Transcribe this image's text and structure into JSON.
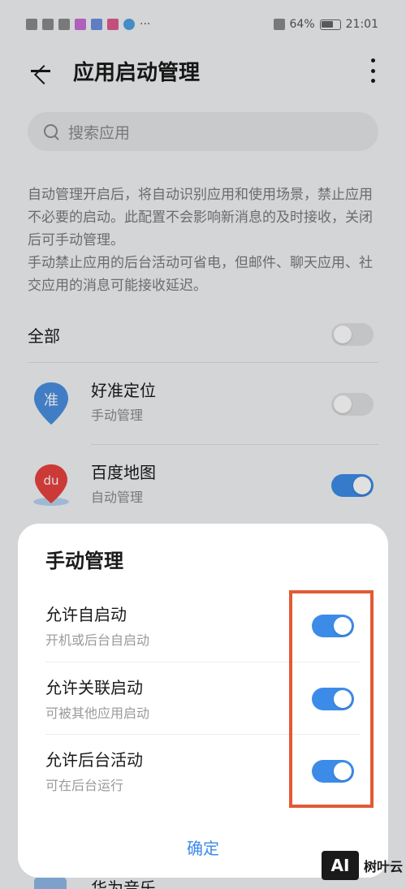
{
  "status_bar": {
    "battery": "64%",
    "time": "21:01",
    "dots": "···"
  },
  "header": {
    "title": "应用启动管理"
  },
  "search": {
    "placeholder": "搜索应用"
  },
  "description": {
    "para1": "自动管理开启后，将自动识别应用和使用场景，禁止应用不必要的启动。此配置不会影响新消息的及时接收，关闭后可手动管理。",
    "para2": "手动禁止应用的后台活动可省电，但邮件、聊天应用、社交应用的消息可能接收延迟。"
  },
  "list": {
    "all_label": "全部",
    "all_on": false,
    "apps": [
      {
        "name": "好准定位",
        "mode": "手动管理",
        "on": false,
        "icon": "location-pin-icon",
        "icon_text": "准"
      },
      {
        "name": "百度地图",
        "mode": "自动管理",
        "on": true,
        "icon": "baidu-map-icon",
        "icon_text": "du"
      }
    ],
    "peek_app": "华为音乐"
  },
  "sheet": {
    "title": "手动管理",
    "rows": [
      {
        "label": "允许自启动",
        "sub": "开机或后台自启动",
        "on": true
      },
      {
        "label": "允许关联启动",
        "sub": "可被其他应用启动",
        "on": true
      },
      {
        "label": "允许后台活动",
        "sub": "可在后台运行",
        "on": true
      }
    ],
    "confirm_label": "确定"
  },
  "watermark": {
    "logo": "AI",
    "text": "树叶云"
  },
  "colors": {
    "accent": "#3d8be8",
    "highlight": "#e25a35"
  }
}
